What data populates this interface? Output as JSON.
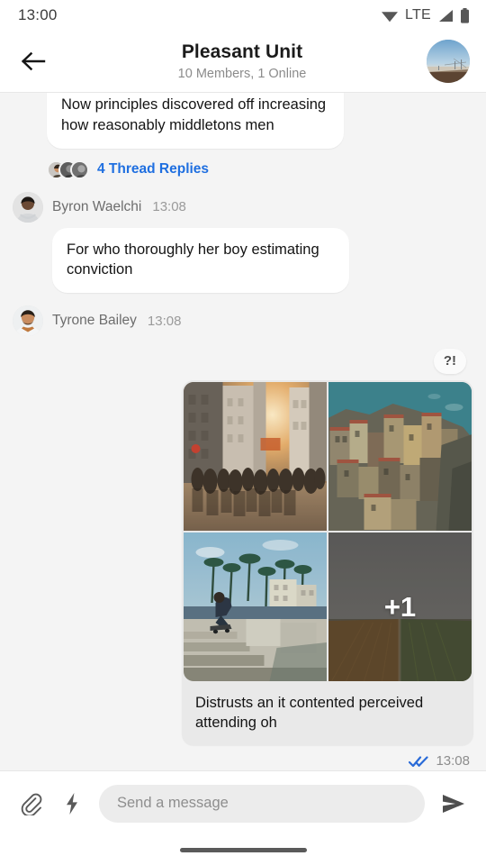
{
  "status_bar": {
    "time": "13:00",
    "network_label": "LTE",
    "icons": [
      "wifi-icon",
      "signal-icon",
      "battery-icon"
    ]
  },
  "header": {
    "back_icon": "back-arrow-icon",
    "title": "Pleasant Unit",
    "subtitle": "10 Members, 1 Online",
    "avatar_name": "group-avatar"
  },
  "conversation": {
    "partial_message": {
      "text": "Now principles discovered off increasing how reasonably middletons men"
    },
    "thread": {
      "label": "4 Thread Replies",
      "avatar_count": 3,
      "link_color": "#1f6fe0"
    },
    "messages": [
      {
        "sender": "Byron Waelchi",
        "time": "13:08",
        "text": "For who thoroughly her boy estimating conviction"
      },
      {
        "sender": "Tyrone Bailey",
        "time": "13:08",
        "text": ""
      }
    ],
    "outgoing": {
      "reaction": "?!",
      "caption": "Distrusts an it contented perceived attending oh",
      "time": "13:08",
      "read_status": "read-double-check-icon",
      "read_color": "#2a6bd8",
      "images": [
        {
          "name": "city-street-sunset-photo"
        },
        {
          "name": "cliffside-village-photo"
        },
        {
          "name": "skatepark-palms-photo"
        },
        {
          "name": "field-landscape-photo"
        }
      ],
      "more_count": "+1"
    }
  },
  "composer": {
    "attach_icon": "paperclip-icon",
    "quick_action_icon": "lightning-bolt-icon",
    "placeholder": "Send a message",
    "value": "",
    "send_icon": "send-arrow-icon"
  },
  "colors": {
    "chat_background": "#f4f4f4",
    "bubble_incoming": "#ffffff",
    "media_card": "#e9e9e9",
    "accent": "#1f6fe0"
  }
}
